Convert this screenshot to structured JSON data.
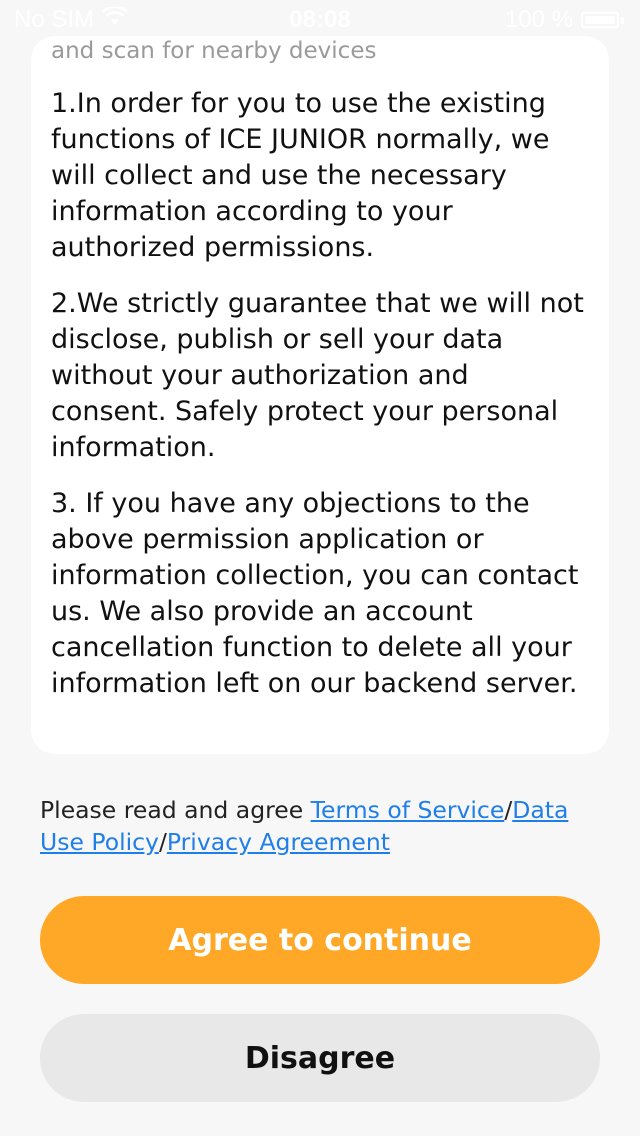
{
  "status_bar": {
    "carrier": "No SIM",
    "time": "08:08",
    "battery_percent": "100 %",
    "icons": [
      "wifi-icon",
      "battery-icon"
    ]
  },
  "card": {
    "faded_line": "and scan for nearby devices",
    "paragraphs": [
      "1.In order for you to use the existing functions of ICE JUNIOR normally, we will collect and use the necessary information according to your authorized permissions.",
      "2.We strictly guarantee that we will not disclose, publish or sell your data without your authorization and consent. Safely protect your personal information.",
      "3. If you have any objections to the above permission application or information collection, you can contact us. We also provide an account cancellation function to delete all your information left on our backend server."
    ]
  },
  "agreement": {
    "prefix": "Please read and agree ",
    "terms_link": "Terms of Service",
    "separator_1": "/",
    "data_use_link": "Data Use Policy",
    "separator_2": "/",
    "privacy_link": "Privacy Agreement"
  },
  "buttons": {
    "agree_label": "Agree to continue",
    "disagree_label": "Disagree"
  },
  "colors": {
    "accent": "#ffa726",
    "link": "#1f7ee8",
    "background": "#f7f7f7",
    "card": "#ffffff",
    "secondary_button": "#e8e8e8"
  }
}
